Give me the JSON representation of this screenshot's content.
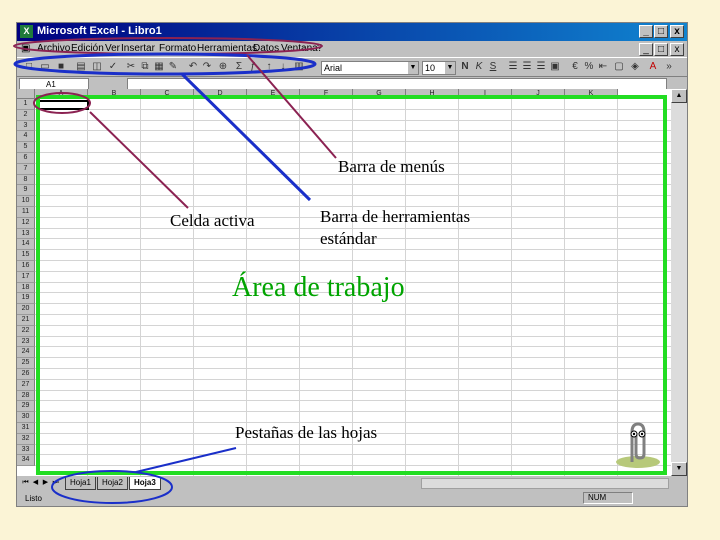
{
  "window": {
    "title": "Microsoft Excel - Libro1",
    "app_icon": "excel-icon",
    "buttons": [
      "_",
      "□",
      "x"
    ],
    "doc_buttons": [
      "_",
      "□",
      "x"
    ]
  },
  "menu": {
    "items": [
      "Archivo",
      "Edición",
      "Ver",
      "Insertar",
      "Formato",
      "Herramientas",
      "Datos",
      "Ventana",
      "?"
    ]
  },
  "toolbar": {
    "font_name": "Arial",
    "font_size": "10",
    "bold": "N",
    "italic": "K",
    "underline": "S"
  },
  "formula_bar": {
    "name_box": "A1"
  },
  "grid": {
    "columns": [
      "A",
      "B",
      "C",
      "D",
      "E",
      "F",
      "G",
      "H",
      "I",
      "J",
      "K"
    ],
    "rows": [
      "1",
      "2",
      "3",
      "4",
      "5",
      "6",
      "7",
      "8",
      "9",
      "10",
      "11",
      "12",
      "13",
      "14",
      "15",
      "16",
      "17",
      "18",
      "19",
      "20",
      "21",
      "22",
      "23",
      "24",
      "25",
      "26",
      "27",
      "28",
      "29",
      "30",
      "31",
      "32",
      "33",
      "34"
    ]
  },
  "sheets": {
    "tabs": [
      "Hoja1",
      "Hoja2",
      "Hoja3"
    ],
    "active": "Hoja3"
  },
  "status": {
    "ready": "Listo",
    "num": "NUM"
  },
  "annotations": {
    "menu_bar": "Barra de menús",
    "active_cell": "Celda activa",
    "standard_toolbar_line1": "Barra de herramientas",
    "standard_toolbar_line2": "estándar",
    "work_area": "Área de trabajo",
    "sheet_tabs": "Pestañas de las hojas"
  },
  "colors": {
    "highlight_green": "#22dd22",
    "menu_oval": "#8b2252",
    "toolbar_oval": "#1a2fc9",
    "background": "#fbf4d6"
  }
}
